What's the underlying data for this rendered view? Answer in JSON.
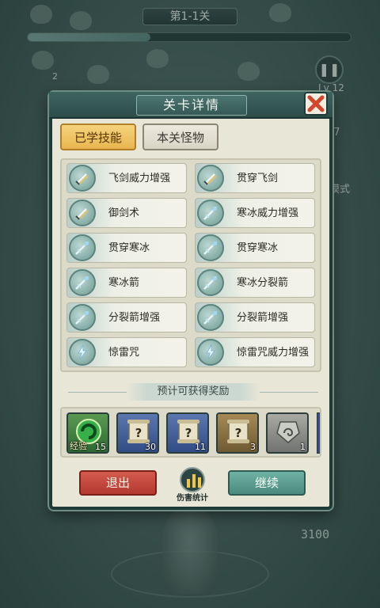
{
  "hud": {
    "stage_title": "第1-1关",
    "level": "Lv 12",
    "side_number": "47",
    "mode_label": "模式",
    "score": "3100",
    "badge_2": "2",
    "progress": 0.38
  },
  "dialog": {
    "title": "关卡详情",
    "tabs": [
      {
        "label": "已学技能",
        "active": true
      },
      {
        "label": "本关怪物",
        "active": false
      }
    ],
    "skills": [
      {
        "label": "飞剑威力增强",
        "icon": "sword-icon"
      },
      {
        "label": "贯穿飞剑",
        "icon": "sword-icon"
      },
      {
        "label": "御剑术",
        "icon": "sword-icon"
      },
      {
        "label": "寒冰威力增强",
        "icon": "ice-arrow-icon"
      },
      {
        "label": "贯穿寒冰",
        "icon": "ice-arrow-icon"
      },
      {
        "label": "贯穿寒冰",
        "icon": "ice-arrow-icon"
      },
      {
        "label": "寒冰箭",
        "icon": "ice-arrow-icon"
      },
      {
        "label": "寒冰分裂箭",
        "icon": "ice-arrow-icon"
      },
      {
        "label": "分裂箭增强",
        "icon": "ice-arrow-icon"
      },
      {
        "label": "分裂箭增强",
        "icon": "ice-arrow-icon"
      },
      {
        "label": "惊雷咒",
        "icon": "lightning-icon"
      },
      {
        "label": "惊雷咒威力增强",
        "icon": "lightning-icon"
      }
    ],
    "reward_header": "预计可获得奖励",
    "rewards": [
      {
        "tag": "经验",
        "count": "15",
        "icon": "exp-orb-icon",
        "color": "green"
      },
      {
        "tag": "",
        "count": "30",
        "icon": "mystery-scroll-icon",
        "color": "blue"
      },
      {
        "tag": "",
        "count": "11",
        "icon": "mystery-scroll-icon",
        "color": "blue"
      },
      {
        "tag": "",
        "count": "3",
        "icon": "mystery-scroll-icon",
        "color": "gold"
      },
      {
        "tag": "",
        "count": "1",
        "icon": "amulet-icon",
        "color": "gray"
      }
    ],
    "exit_label": "退出",
    "stats_label": "伤害统计",
    "continue_label": "继续"
  },
  "colors": {
    "exit": "#c6473d",
    "continue": "#5c9e90",
    "active_tab": "#efc467",
    "panel": "#e8e6d6"
  }
}
